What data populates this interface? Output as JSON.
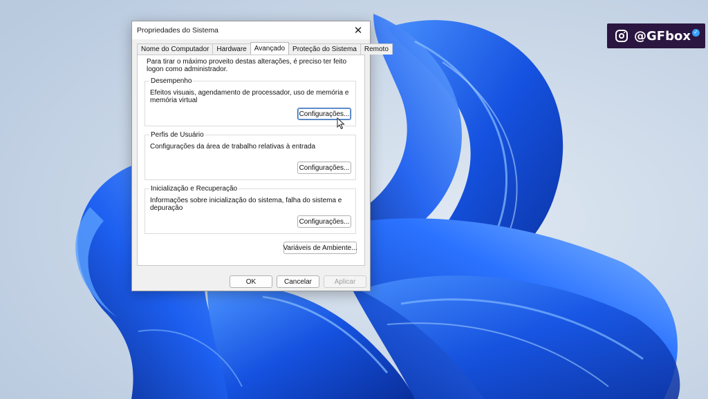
{
  "dialog": {
    "title": "Propriedades do Sistema",
    "close_glyph": "✕",
    "tabs": [
      {
        "label": "Nome do Computador",
        "active": false
      },
      {
        "label": "Hardware",
        "active": false
      },
      {
        "label": "Avançado",
        "active": true
      },
      {
        "label": "Proteção do Sistema",
        "active": false
      },
      {
        "label": "Remoto",
        "active": false
      }
    ],
    "admin_note": "Para tirar o máximo proveito destas alterações, é preciso ter feito logon como administrador.",
    "groups": [
      {
        "legend": "Desempenho",
        "description": "Efeitos visuais, agendamento de processador, uso de memória e memória virtual",
        "button": "Configurações..."
      },
      {
        "legend": "Perfis de Usuário",
        "description": "Configurações da área de trabalho relativas à entrada",
        "button": "Configurações..."
      },
      {
        "legend": "Inicialização e Recuperação",
        "description": "Informações sobre inicialização do sistema, falha do sistema e depuração",
        "button": "Configurações..."
      }
    ],
    "env_button": "Variáveis de Ambiente...",
    "footer": {
      "ok": "OK",
      "cancel": "Cancelar",
      "apply": "Aplicar",
      "apply_enabled": false
    }
  },
  "badge": {
    "icon": "instagram-icon",
    "handle": "@GFbox",
    "verified_icon": "verified-check-icon",
    "background": "#2a1640"
  },
  "colors": {
    "wallpaper_bg": "#c9d7e6",
    "bloom_blue": "#1f5fe0",
    "focus_blue": "#3a6fb5"
  }
}
